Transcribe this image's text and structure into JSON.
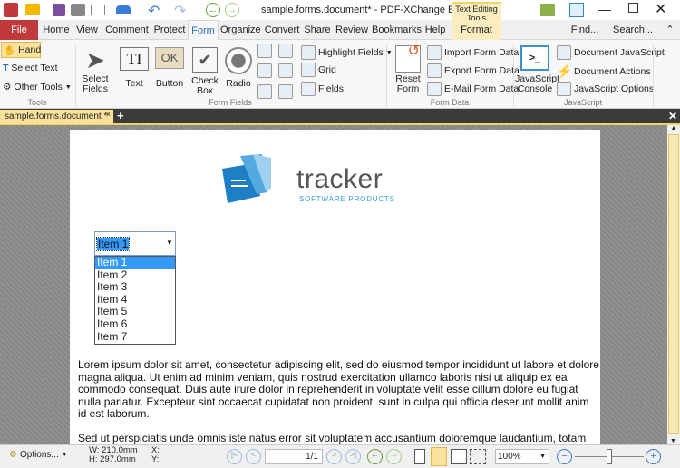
{
  "titlebar": {
    "title": "sample.forms.document* - PDF-XChange Editor",
    "context_tab": "Text Editing Tools"
  },
  "menu_tabs": [
    "File",
    "Home",
    "View",
    "Comment",
    "Protect",
    "Form",
    "Organize",
    "Convert",
    "Share",
    "Review",
    "Bookmarks",
    "Help",
    "Format"
  ],
  "active_tab": "Form",
  "find": "Find...",
  "search": "Search...",
  "ribbon": {
    "tools": {
      "hand": "Hand",
      "select_text": "Select Text",
      "other_tools": "Other Tools",
      "group": "Tools"
    },
    "form_fields": {
      "select_fields": "Select Fields",
      "text": "Text",
      "button": "Button",
      "check_box": "Check Box",
      "radio": "Radio",
      "highlight_fields": "Highlight Fields",
      "grid": "Grid",
      "fields": "Fields",
      "group": "Form Fields",
      "button_face": "OK"
    },
    "form_data": {
      "reset_form": "Reset Form",
      "import": "Import Form Data",
      "export": "Export Form Data",
      "email": "E-Mail Form Data",
      "group": "Form Data"
    },
    "javascript": {
      "console": "JavaScript Console",
      "doc_js": "Document JavaScript",
      "doc_actions": "Document Actions",
      "js_options": "JavaScript Options",
      "group": "JavaScript"
    }
  },
  "doc_tab": "sample.forms.document *",
  "document": {
    "logo_name": "tracker",
    "logo_sub": "SOFTWARE PRODUCTS",
    "dropdown_value": "Item 1",
    "dropdown_items": [
      "Item 1",
      "Item 2",
      "Item 3",
      "Item 4",
      "Item 5",
      "Item 6",
      "Item 7"
    ],
    "paragraph1": "Lorem ipsum dolor sit amet, consectetur adipiscing elit, sed do eiusmod tempor incididunt ut labore et dolore magna aliqua. Ut enim ad minim veniam, quis nostrud exercitation ullamco laboris nisi ut aliquip ex ea commodo consequat. Duis aute irure dolor in reprehenderit in voluptate velit esse cillum dolore eu fugiat nulla pariatur. Excepteur sint occaecat cupidatat non proident, sunt in culpa qui officia deserunt mollit anim id est laborum.",
    "paragraph2": "Sed ut perspiciatis unde omnis iste natus error sit voluptatem accusantium doloremque laudantium, totam"
  },
  "status": {
    "options": "Options...",
    "width": "W: 210.0mm",
    "height": "H: 297.0mm",
    "x": "X:",
    "y": "Y:",
    "page": "1/1",
    "zoom": "100%"
  },
  "colors": {
    "file_tab": "#c0393b",
    "accent": "#f2d35b",
    "selection": "#3399ff"
  }
}
